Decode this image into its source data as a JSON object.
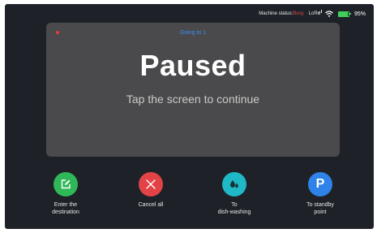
{
  "status_bar": {
    "machine_status_label": "Machine status:",
    "machine_status_value": "Busy",
    "lora_label": "LoRa",
    "battery_percent": "95%",
    "battery_level": 0.95
  },
  "panel": {
    "going_to": "Going to 1",
    "title": "Paused",
    "subtitle": "Tap the screen to continue"
  },
  "actions": [
    {
      "label": "Enter the\ndestination",
      "icon": "edit-icon",
      "color": "#30b858"
    },
    {
      "label": "Cancel all",
      "icon": "close-icon",
      "color": "#e24347"
    },
    {
      "label": "To\ndish-washing",
      "icon": "water-drops-icon",
      "color": "#1fb8c6"
    },
    {
      "label": "To standby\npoint",
      "icon": "parking-icon",
      "color": "#2f83e8",
      "glyph": "P"
    }
  ],
  "colors": {
    "background": "#1e2228",
    "panel": "#4a4a4c",
    "accent_blue": "#3f8df0",
    "busy_red": "#e54848",
    "battery_green": "#3fcf5a"
  }
}
